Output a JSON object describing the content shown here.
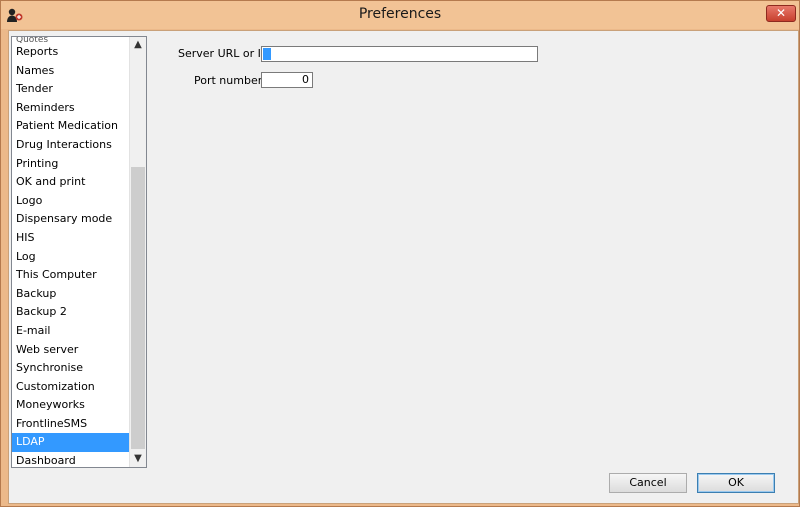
{
  "window": {
    "title": "Preferences",
    "close_symbol": "✕",
    "app_icon": "app-logo-icon"
  },
  "sidebar": {
    "partial_top_item": "Quotes",
    "items": [
      {
        "label": "Reports"
      },
      {
        "label": "Names"
      },
      {
        "label": "Tender"
      },
      {
        "label": "Reminders"
      },
      {
        "label": "Patient Medication"
      },
      {
        "label": "Drug Interactions"
      },
      {
        "label": "Printing"
      },
      {
        "label": "OK and print"
      },
      {
        "label": "Logo"
      },
      {
        "label": "Dispensary mode"
      },
      {
        "label": "HIS"
      },
      {
        "label": "Log"
      },
      {
        "label": "This Computer"
      },
      {
        "label": "Backup"
      },
      {
        "label": "Backup 2"
      },
      {
        "label": "E-mail"
      },
      {
        "label": "Web server"
      },
      {
        "label": "Synchronise"
      },
      {
        "label": "Customization"
      },
      {
        "label": "Moneyworks"
      },
      {
        "label": "FrontlineSMS"
      },
      {
        "label": "LDAP",
        "selected": true
      },
      {
        "label": "Dashboard"
      }
    ],
    "scroll_up_symbol": "▲",
    "scroll_down_symbol": "▼"
  },
  "ldap": {
    "server_label": "Server URL or IP",
    "server_value": "",
    "port_label": "Port number",
    "port_value": "0"
  },
  "buttons": {
    "cancel": "Cancel",
    "ok": "OK"
  },
  "colors": {
    "selection": "#3399ff",
    "titlebar": "#f2c395",
    "close": "#c7402e"
  }
}
